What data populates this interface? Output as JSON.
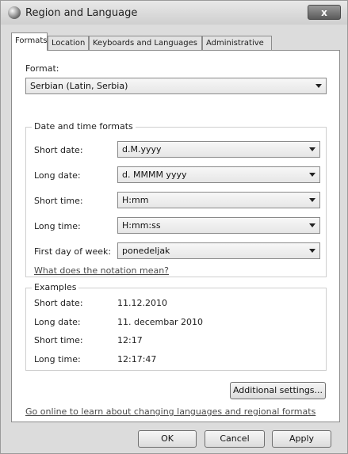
{
  "window": {
    "title": "Region and Language",
    "close_label": "x"
  },
  "tabs": [
    {
      "label": "Formats"
    },
    {
      "label": "Location"
    },
    {
      "label": "Keyboards and Languages"
    },
    {
      "label": "Administrative"
    }
  ],
  "format": {
    "label": "Format:",
    "value": "Serbian (Latin, Serbia)"
  },
  "datetime": {
    "title": "Date and time formats",
    "short_date": {
      "label": "Short date:",
      "value": "d.M.yyyy"
    },
    "long_date": {
      "label": "Long date:",
      "value": "d. MMMM yyyy"
    },
    "short_time": {
      "label": "Short time:",
      "value": "H:mm"
    },
    "long_time": {
      "label": "Long time:",
      "value": "H:mm:ss"
    },
    "first_day": {
      "label": "First day of week:",
      "value": "ponedeljak"
    },
    "notation_link": "What does the notation mean?"
  },
  "examples": {
    "title": "Examples",
    "rows": [
      {
        "label": "Short date:",
        "value": "11.12.2010"
      },
      {
        "label": "Long date:",
        "value": "11. decembar 2010"
      },
      {
        "label": "Short time:",
        "value": "12:17"
      },
      {
        "label": "Long time:",
        "value": "12:17:47"
      }
    ]
  },
  "additional_settings_label": "Additional settings...",
  "online_link": "Go online to learn about changing languages and regional formats",
  "buttons": {
    "ok": "OK",
    "cancel": "Cancel",
    "apply": "Apply"
  }
}
